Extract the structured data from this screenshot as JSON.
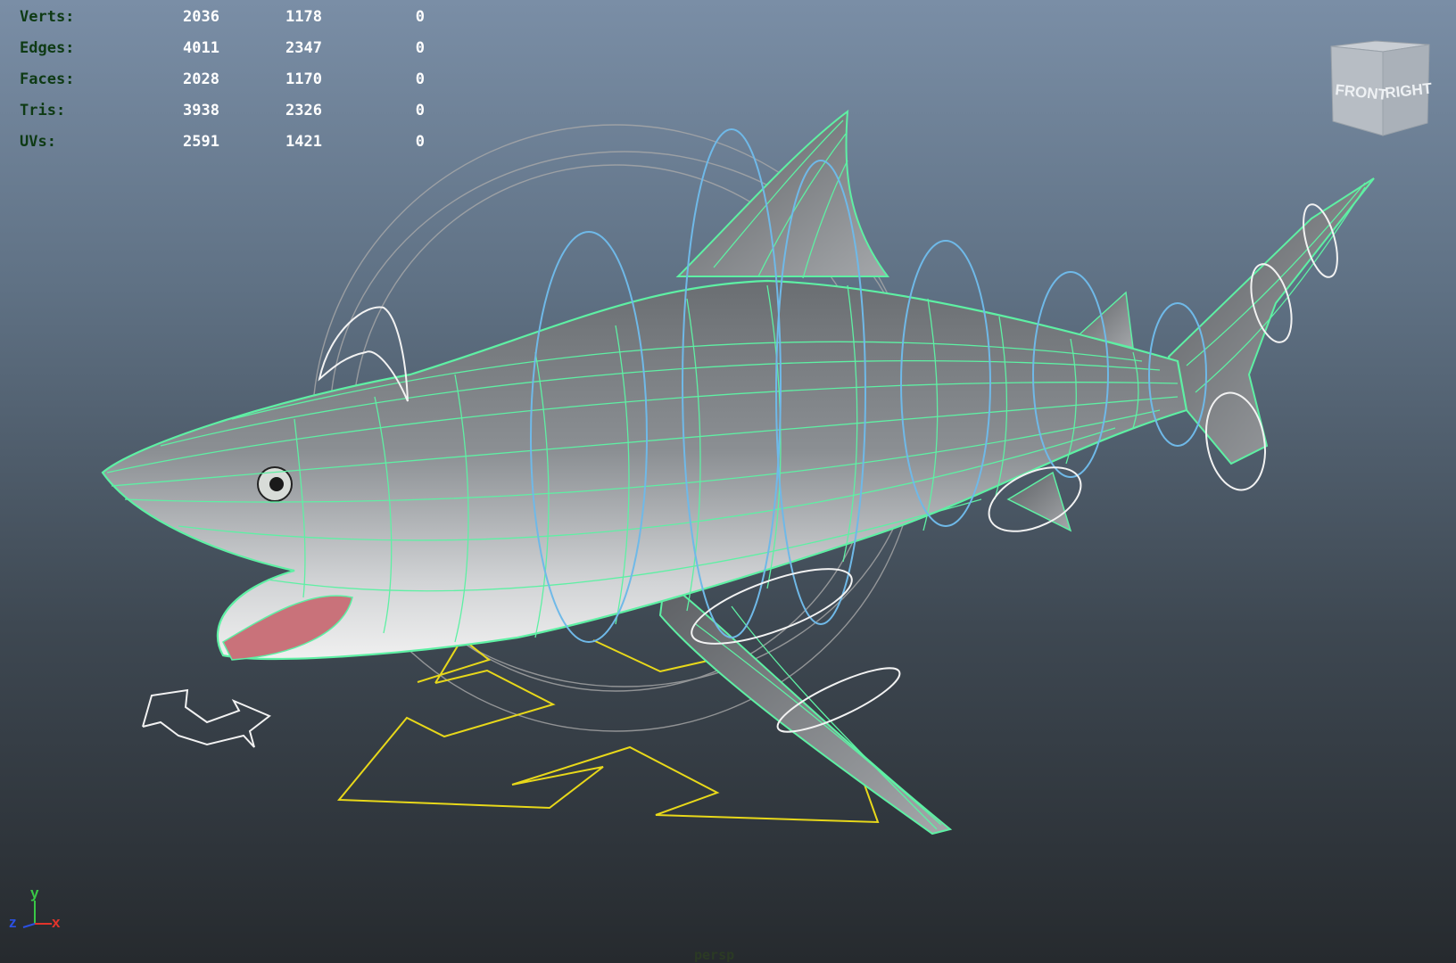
{
  "hud": {
    "rows": [
      {
        "label": "Verts:",
        "values": [
          "2036",
          "1178",
          "0"
        ]
      },
      {
        "label": "Edges:",
        "values": [
          "4011",
          "2347",
          "0"
        ]
      },
      {
        "label": "Faces:",
        "values": [
          "2028",
          "1170",
          "0"
        ]
      },
      {
        "label": "Tris:",
        "values": [
          "3938",
          "2326",
          "0"
        ]
      },
      {
        "label": "UVs:",
        "values": [
          "2591",
          "1421",
          "0"
        ]
      }
    ]
  },
  "viewcube": {
    "front_label": "FRONT",
    "right_label": "RIGHT"
  },
  "axis": {
    "y_label": "y",
    "z_label": "z",
    "x_label": "x"
  },
  "camera_label": "persp",
  "colors": {
    "wireframe": "#5ef0a4",
    "control_curve_blue": "#6fb9e8",
    "control_curve_white": "#f2f2f2",
    "control_curve_yellow": "#e8d81a",
    "hud_label": "#0e3a14",
    "hud_value": "#ffffff"
  }
}
